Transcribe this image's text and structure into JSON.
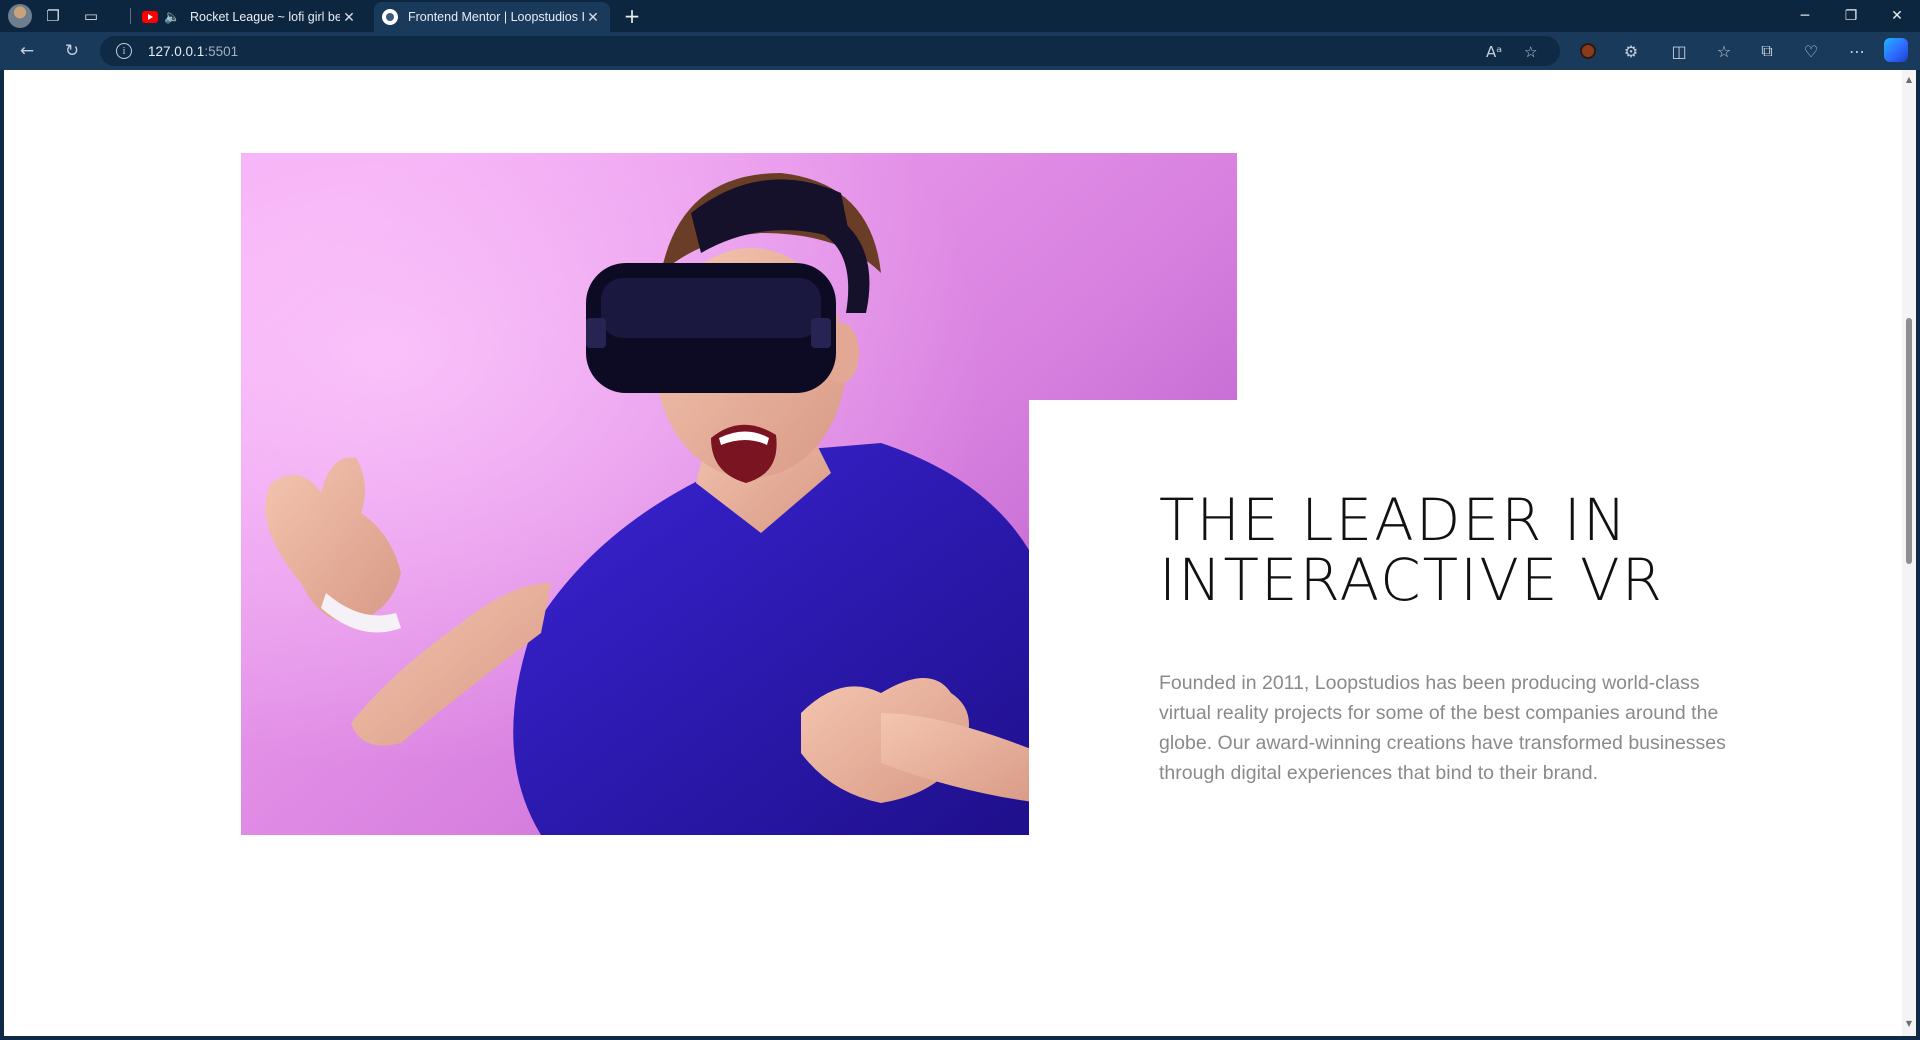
{
  "browser": {
    "tabs": [
      {
        "title": "Rocket League ~ lofi girl be",
        "active": false,
        "favicon": "youtube-icon",
        "muted_indicator": "speaker-icon"
      },
      {
        "title": "Frontend Mentor | Loopstudios I",
        "active": true,
        "favicon": "frontend-mentor-icon"
      }
    ],
    "url_host": "127.0.0.1",
    "url_port": ":5501"
  },
  "page": {
    "headline": "THE LEADER IN INTERACTIVE VR",
    "body": "Founded in 2011, Loopstudios has been producing world-class virtual reality projects for some of the best companies around the globe. Our award-winning creations have transformed businesses through digital experiences that bind to their brand."
  },
  "colors": {
    "tab_strip": "#0d2640",
    "toolbar": "#1a3a5c",
    "hero_bg_light": "#f2a6f0",
    "hero_bg_dark": "#b85ac9",
    "shirt": "#2d19b8",
    "text_heading": "#111111",
    "text_body": "#8a8a8a"
  }
}
